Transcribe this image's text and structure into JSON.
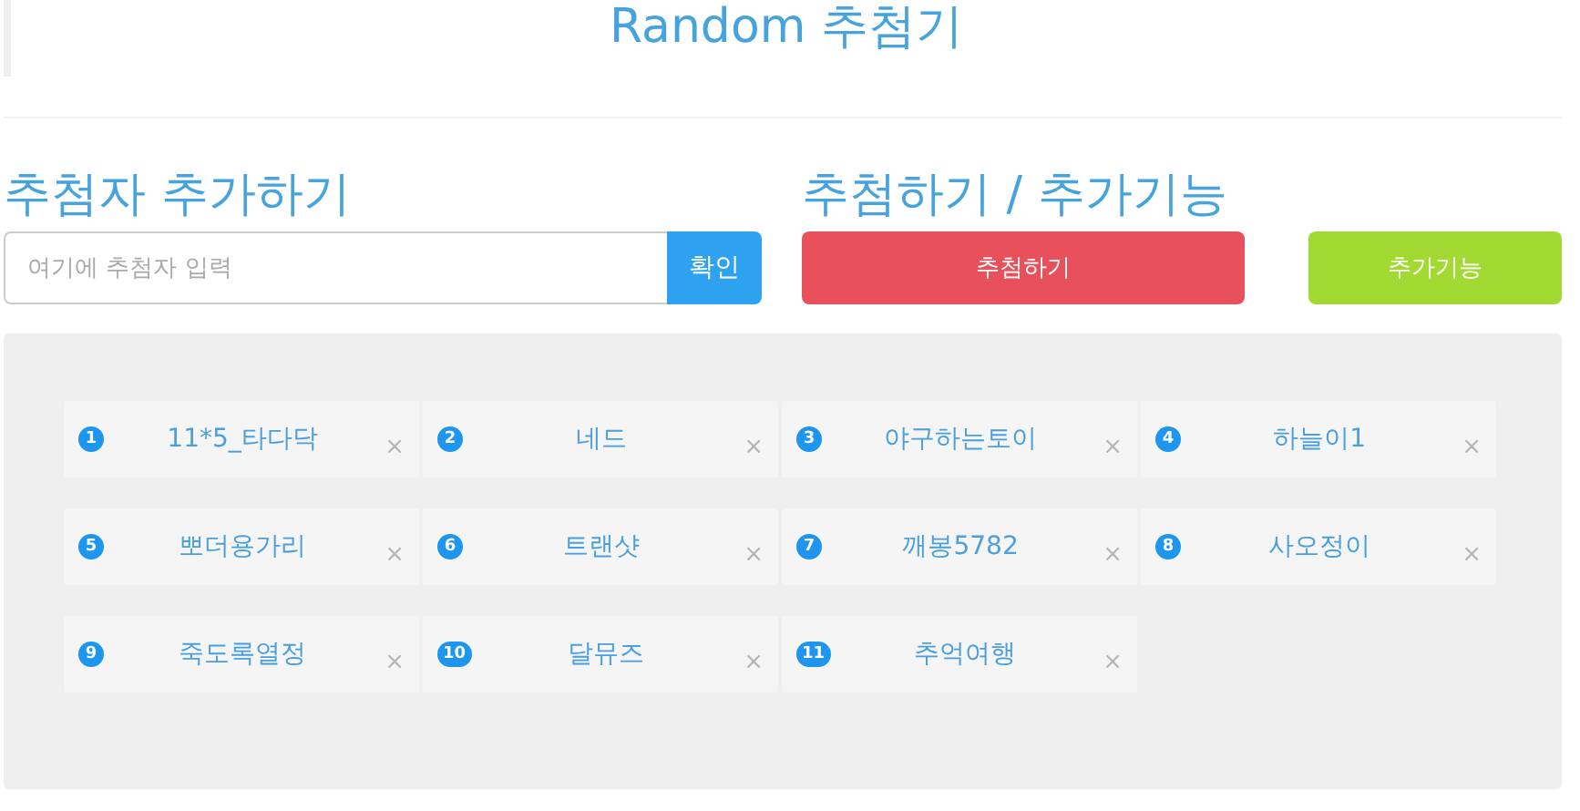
{
  "title": "Random 추첨기",
  "add_section": {
    "heading": "추첨자 추가하기",
    "input": {
      "placeholder": "여기에 추첨자 입력"
    },
    "confirm_button": "확인"
  },
  "draw_section": {
    "heading": "추첨하기 / 추가기능",
    "draw_button": "추첨하기",
    "extra_button": "추가기능"
  },
  "entries": [
    {
      "number": "1",
      "name": "11*5_타다닥",
      "remove": "×"
    },
    {
      "number": "2",
      "name": "네드",
      "remove": "×"
    },
    {
      "number": "3",
      "name": "야구하는토이",
      "remove": "×"
    },
    {
      "number": "4",
      "name": "하늘이1",
      "remove": "×"
    },
    {
      "number": "5",
      "name": "뽀더용가리",
      "remove": "×"
    },
    {
      "number": "6",
      "name": "트랜샷",
      "remove": "×"
    },
    {
      "number": "7",
      "name": "깨봉5782",
      "remove": "×"
    },
    {
      "number": "8",
      "name": "사오정이",
      "remove": "×"
    },
    {
      "number": "9",
      "name": "죽도록열정",
      "remove": "×"
    },
    {
      "number": "10",
      "name": "달뮤즈",
      "remove": "×"
    },
    {
      "number": "11",
      "name": "추억여행",
      "remove": "×"
    }
  ]
}
